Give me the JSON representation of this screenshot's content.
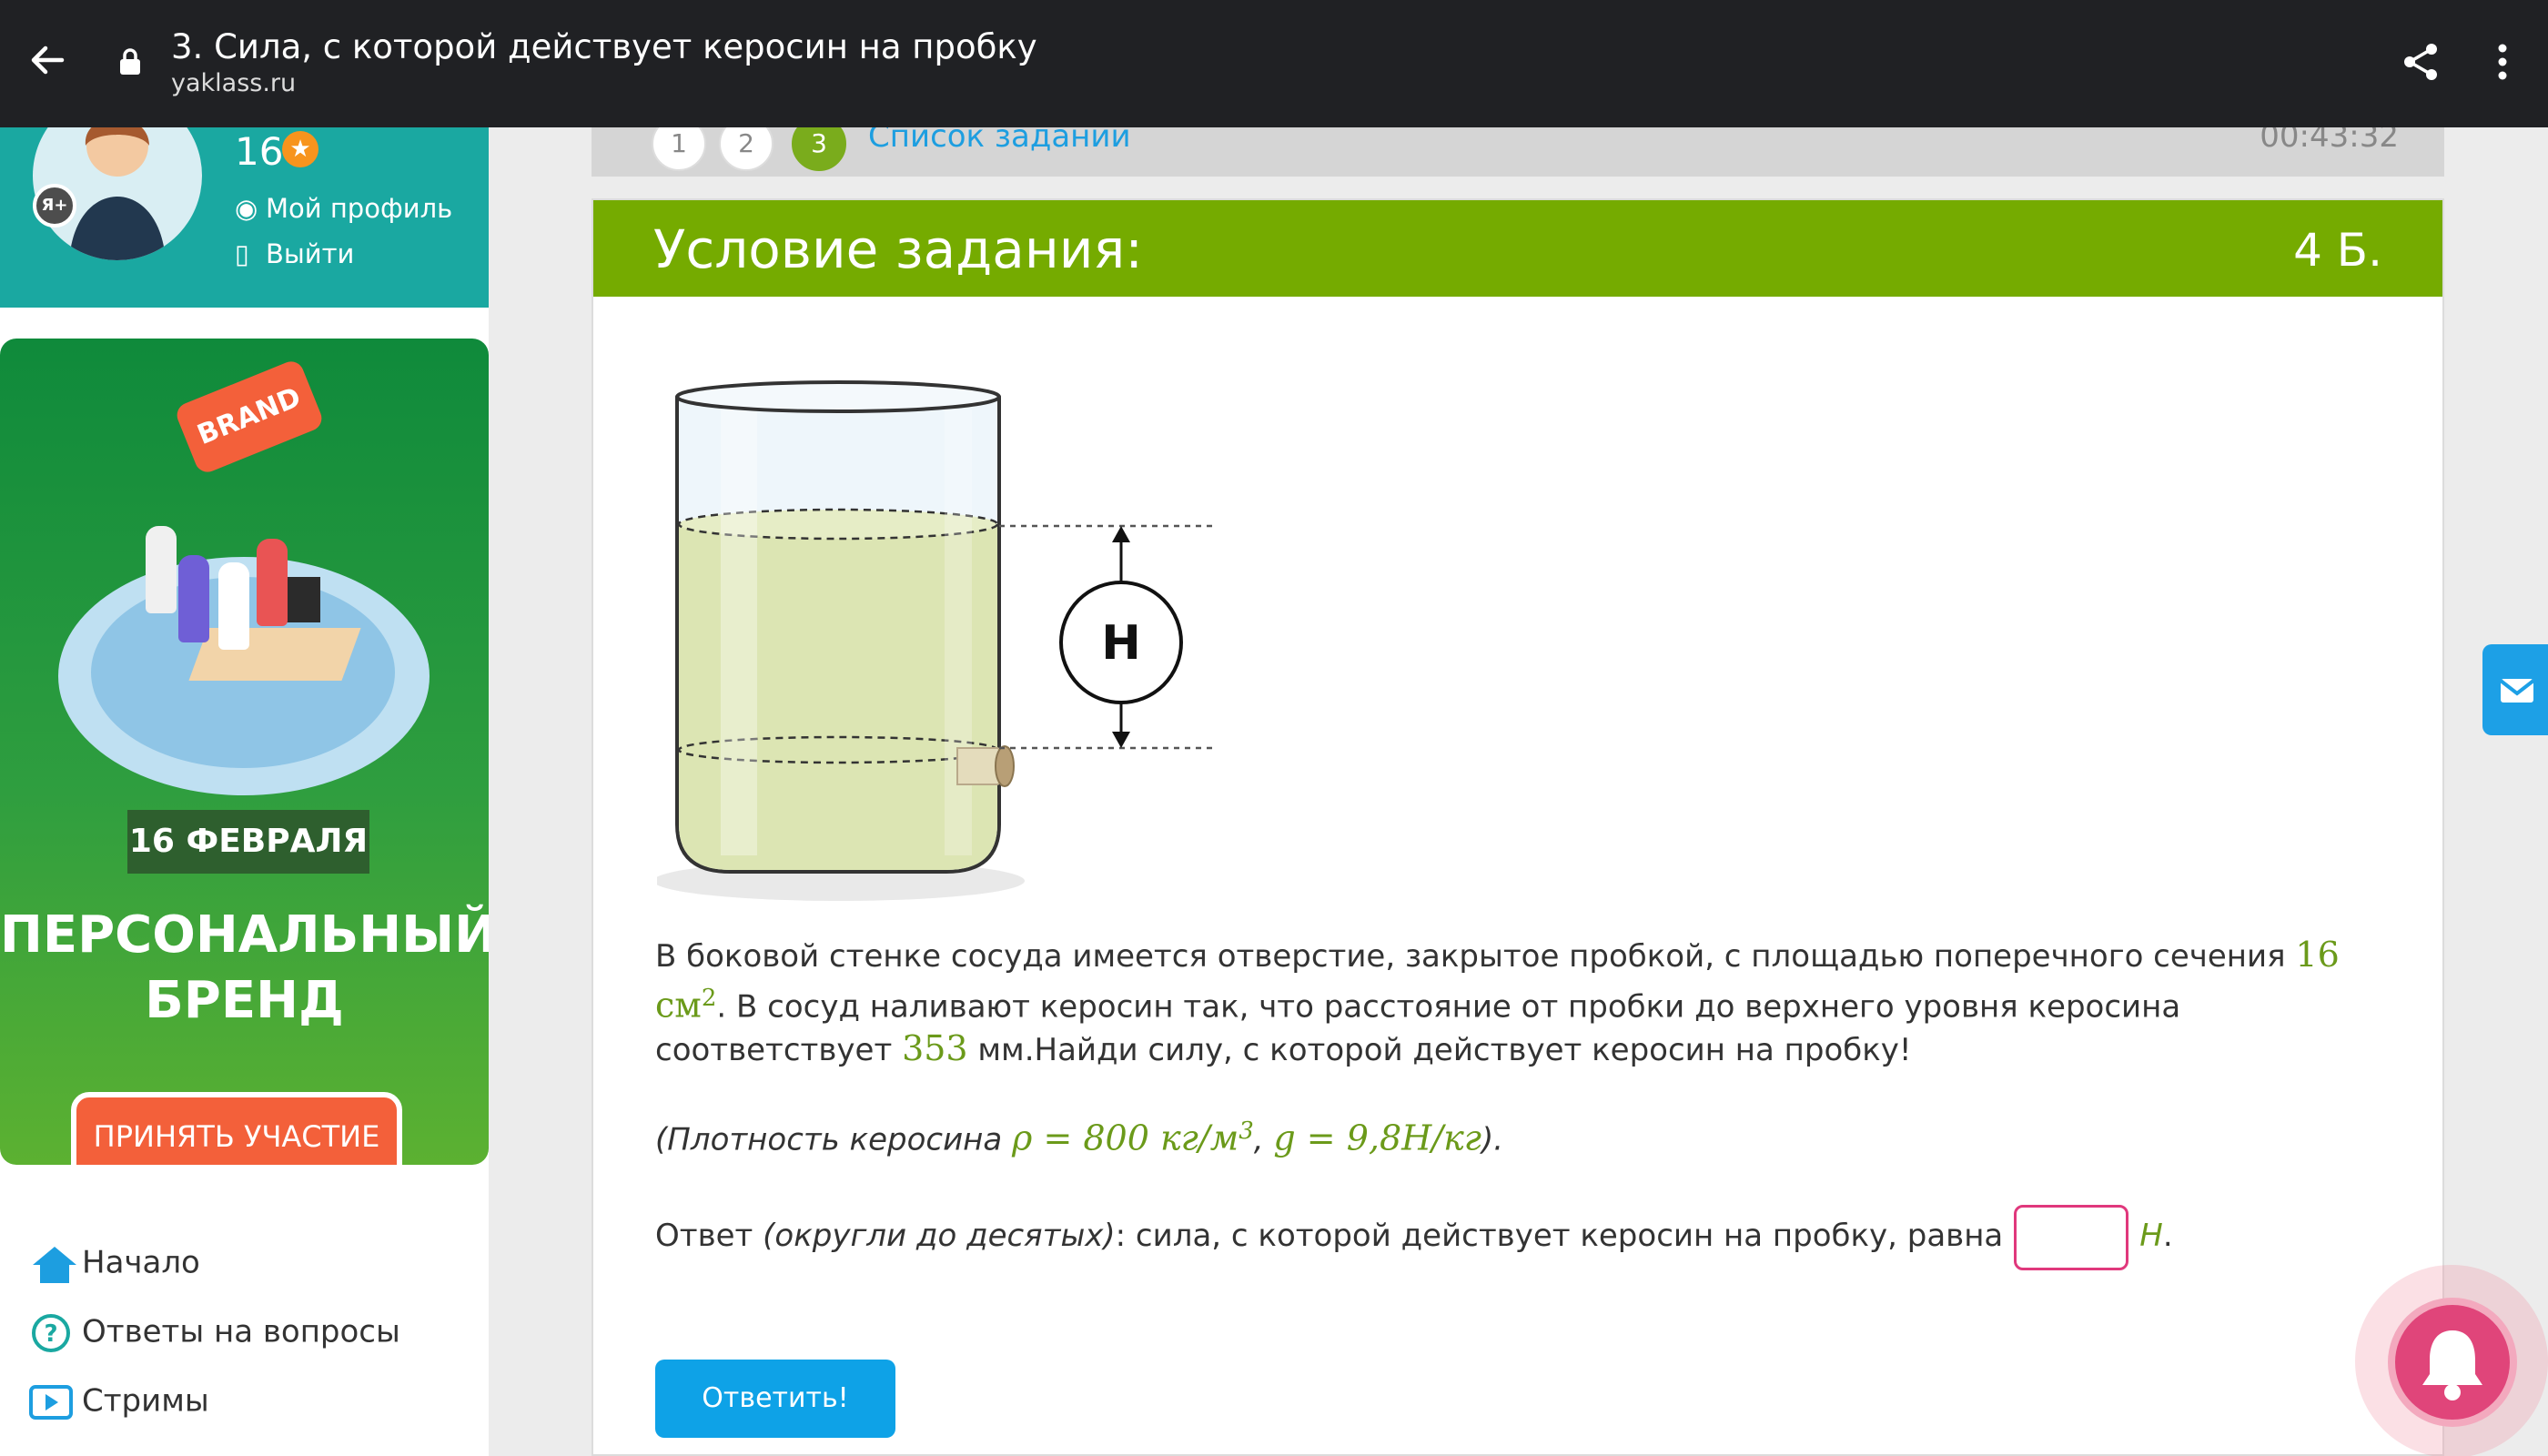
{
  "browser": {
    "title": "3. Сила, с которой действует керосин на пробку",
    "url": "yaklass.ru"
  },
  "profile": {
    "avatar_badge": "Я+",
    "points": "16",
    "links": [
      "Мой профиль",
      "Выйти"
    ]
  },
  "banner": {
    "brand_sign": "BRAND",
    "date": "16 ФЕВРАЛЯ",
    "headline_line1": "ПЕРСОНАЛЬНЫЙ",
    "headline_line2": "БРЕНД",
    "cta": "ПРИНЯТЬ УЧАСТИЕ"
  },
  "nav": {
    "items": [
      "Начало",
      "Ответы на вопросы",
      "Стримы"
    ]
  },
  "task_nav": {
    "steps": [
      "1",
      "2",
      "3"
    ],
    "active_step": "3",
    "tasklist": "Список заданий",
    "timer": "00:43:32"
  },
  "task": {
    "header": "Условие задания:",
    "points": "4 Б.",
    "figure_label": "H",
    "p1_a": "В боковой стенке сосуда имеется отверстие, закрытое пробкой, с площадью поперечного сечения ",
    "area_value": "16 см",
    "area_exp": "2",
    "p1_b": ". В сосуд наливают керосин так, что расстояние от пробки до верхнего уровня керосина соответствует ",
    "distance_value": "353",
    "p1_c": " мм.Найди силу, с которой действует керосин на пробку!",
    "p2_a": "(Плотность керосина ",
    "density": "ρ = 800 кг/м",
    "density_exp": "3",
    "p2_comma": ", ",
    "gravity": "g = 9,8Н/кг",
    "p2_b": ").",
    "p3_a": "Ответ ",
    "p3_hint": "(округли до десятых)",
    "p3_b": ": сила, с которой действует керосин на пробку, равна",
    "unit": "Н",
    "unit_dot": ".",
    "submit": "Ответить!"
  }
}
